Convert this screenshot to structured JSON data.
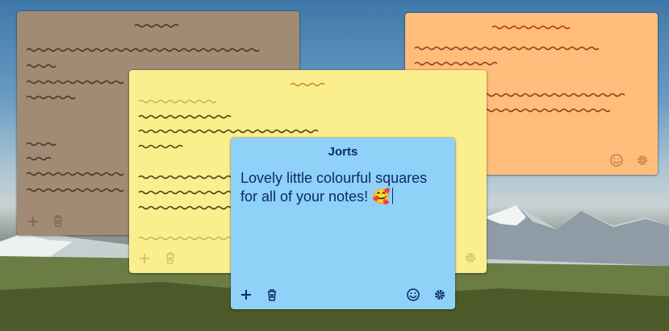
{
  "notes": {
    "active": {
      "title": "Jorts",
      "text_line1": "Lovely little colourful squares",
      "text_line2": "for all of your notes! 🥰",
      "bg": "#8fd1f7",
      "fg": "#0b2a6b"
    },
    "brown": {
      "bg": "#a18b74"
    },
    "yellow": {
      "bg": "#fbee8d"
    },
    "orange": {
      "bg": "#ffbc7a"
    }
  },
  "icons": {
    "add": "plus-icon",
    "delete": "trash-icon",
    "emoji": "emoji-icon",
    "settings": "gear-icon"
  }
}
